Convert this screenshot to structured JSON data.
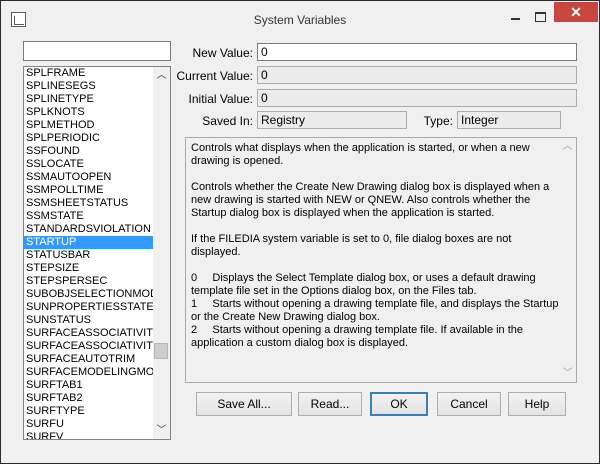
{
  "window": {
    "title": "System Variables",
    "close_glyph": "✕"
  },
  "filter": {
    "value": ""
  },
  "variables": [
    "SPLFRAME",
    "SPLINESEGS",
    "SPLINETYPE",
    "SPLKNOTS",
    "SPLMETHOD",
    "SPLPERIODIC",
    "SSFOUND",
    "SSLOCATE",
    "SSMAUTOOPEN",
    "SSMPOLLTIME",
    "SSMSHEETSTATUS",
    "SSMSTATE",
    "STANDARDSVIOLATION",
    "STARTUP",
    "STATUSBAR",
    "STEPSIZE",
    "STEPSPERSEC",
    "SUBOBJSELECTIONMOD",
    "SUNPROPERTIESSTATE",
    "SUNSTATUS",
    "SURFACEASSOCIATIVITY",
    "SURFACEASSOCIATIVITY",
    "SURFACEAUTOTRIM",
    "SURFACEMODELINGMOD",
    "SURFTAB1",
    "SURFTAB2",
    "SURFTYPE",
    "SURFU",
    "SURFV"
  ],
  "selected_variable": "STARTUP",
  "fields": {
    "new_value_label": "New Value:",
    "new_value": "0",
    "current_value_label": "Current Value:",
    "current_value": "0",
    "initial_value_label": "Initial Value:",
    "initial_value": "0",
    "saved_in_label": "Saved In:",
    "saved_in": "Registry",
    "type_label": "Type:",
    "type": "Integer"
  },
  "description": "Controls what displays when the application is started, or when a new drawing is opened.\n\nControls whether the Create New Drawing dialog box is displayed when a new drawing is started with NEW or QNEW. Also controls whether the Startup dialog box is displayed when the application is started.\n\nIf the FILEDIA system variable is set to 0, file dialog boxes are not displayed.\n\n0     Displays the Select Template dialog box, or uses a default drawing template file set in the Options dialog box, on the Files tab.\n1     Starts without opening a drawing template file, and displays the Startup or the Create New Drawing dialog box.\n2     Starts without opening a drawing template file. If available in the application a custom dialog box is displayed.",
  "buttons": {
    "save_all": "Save All...",
    "read": "Read...",
    "ok": "OK",
    "cancel": "Cancel",
    "help": "Help"
  },
  "icons": {
    "app": "document-icon",
    "minimize": "minimize-icon",
    "maximize": "maximize-icon",
    "close": "close-icon",
    "scroll_up": "chevron-up-icon",
    "scroll_down": "chevron-down-icon"
  },
  "colors": {
    "selection": "#3399ff",
    "close_button": "#c7463d",
    "dialog_bg": "#f0f0f0"
  }
}
